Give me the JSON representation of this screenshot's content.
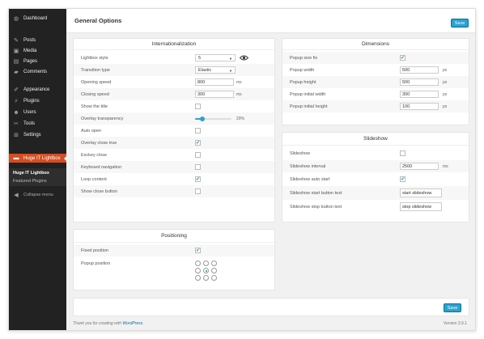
{
  "sidebar": {
    "items": [
      {
        "icon": "dashboard-icon",
        "glyph": "◍",
        "label": "Dashboard"
      },
      {
        "icon": "pin-icon",
        "glyph": "✎",
        "label": "Posts"
      },
      {
        "icon": "media-icon",
        "glyph": "▣",
        "label": "Media"
      },
      {
        "icon": "pages-icon",
        "glyph": "▤",
        "label": "Pages"
      },
      {
        "icon": "comment-icon",
        "glyph": "▰",
        "label": "Comments"
      },
      {
        "icon": "brush-icon",
        "glyph": "✐",
        "label": "Appearance"
      },
      {
        "icon": "plugin-icon",
        "glyph": "⚡",
        "label": "Plugins"
      },
      {
        "icon": "users-icon",
        "glyph": "☻",
        "label": "Users"
      },
      {
        "icon": "wrench-icon",
        "glyph": "✂",
        "label": "Tools"
      },
      {
        "icon": "settings-icon",
        "glyph": "⊞",
        "label": "Settings"
      },
      {
        "icon": "lightbox-icon",
        "glyph": "▬",
        "label": "Huge IT Lightbox"
      }
    ],
    "submenu": [
      "Huge IT Lightbox",
      "Featured Plugins"
    ],
    "collapse": {
      "glyph": "◀",
      "label": "Collapse menu"
    }
  },
  "header": {
    "title": "General Options",
    "save_label": "Save"
  },
  "internationalization": {
    "title": "Internationalization",
    "lightbox_style": {
      "label": "Lightbox style",
      "value": "5"
    },
    "transition_type": {
      "label": "Transition type",
      "value": "Elastic"
    },
    "opening_speed": {
      "label": "Opening speed",
      "value": "800",
      "unit": "ms"
    },
    "closing_speed": {
      "label": "Closing speed",
      "value": "300",
      "unit": "ms"
    },
    "show_title": {
      "label": "Show the title",
      "checked": false
    },
    "overlay_transparency": {
      "label": "Overlay transparency",
      "value": 20,
      "display": "20%"
    },
    "auto_open": {
      "label": "Auto open",
      "checked": false
    },
    "overlay_close_true": {
      "label": "Overlay close true",
      "checked": true
    },
    "esckey_close": {
      "label": "Esckey close",
      "checked": false
    },
    "keyboard_navigation": {
      "label": "Keyboard navigation",
      "checked": false
    },
    "loop_content": {
      "label": "Loop content",
      "checked": true
    },
    "show_close_button": {
      "label": "Show close button",
      "checked": false
    }
  },
  "dimensions": {
    "title": "Dimensions",
    "popup_size_fix": {
      "label": "Popup size fix",
      "checked": true
    },
    "popup_width": {
      "label": "Popup width",
      "value": "500",
      "unit": "px"
    },
    "popup_height": {
      "label": "Popup height",
      "value": "500",
      "unit": "px"
    },
    "popup_initial_width": {
      "label": "Popup initial width",
      "value": "300",
      "unit": "px"
    },
    "popup_initial_height": {
      "label": "Popup initial height",
      "value": "100",
      "unit": "px"
    }
  },
  "slideshow": {
    "title": "Slideshow",
    "slideshow": {
      "label": "Slideshow",
      "checked": false
    },
    "interval": {
      "label": "Slideshow interval",
      "value": "2500",
      "unit": "ms"
    },
    "auto_start": {
      "label": "Slideshow auto start",
      "checked": true
    },
    "start_text": {
      "label": "Slideshow start button text",
      "value": "start slideshow"
    },
    "stop_text": {
      "label": "Slideshow stop button text",
      "value": "stop slideshow"
    }
  },
  "positioning": {
    "title": "Positioning",
    "fixed_position": {
      "label": "Fixed position",
      "checked": true
    },
    "popup_position": {
      "label": "Popup position",
      "selected_index": 4
    }
  },
  "footer": {
    "thanks_prefix": "Thank you for creating with",
    "thanks_link": "WordPress",
    "thanks_suffix": ".",
    "version": "Version 3.9.1",
    "save_label": "Save"
  },
  "colors": {
    "accent": "#2ea2cc",
    "active_menu": "#d54e21",
    "sidebar": "#222222"
  },
  "check_glyph": "✔"
}
